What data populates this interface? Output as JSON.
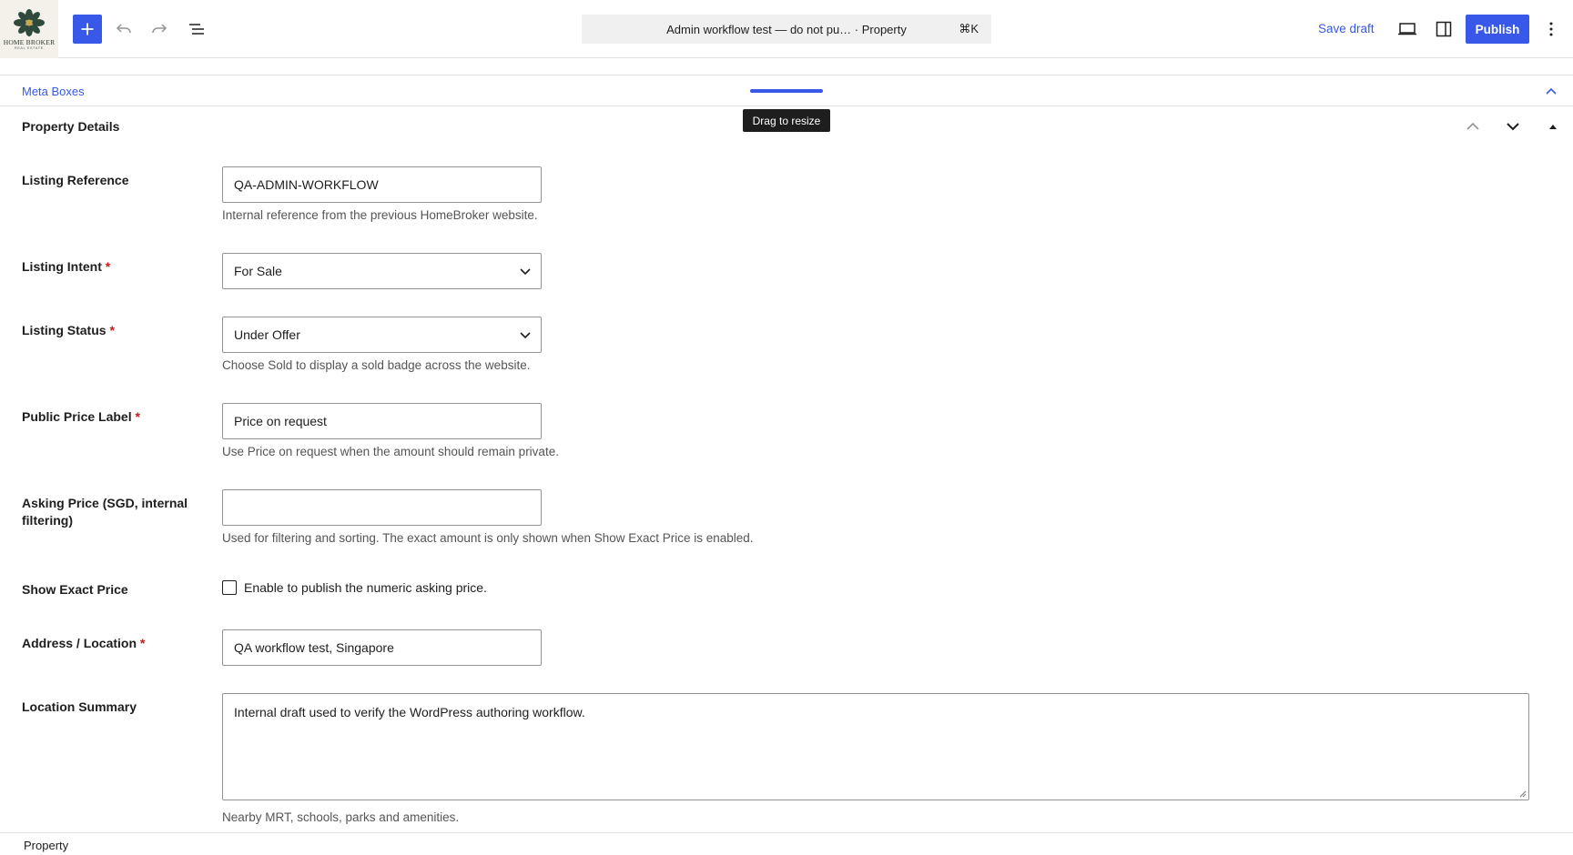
{
  "header": {
    "logo_text": "HOME BROKER",
    "logo_subtext": "REAL ESTATE",
    "command_title": "Admin workflow test — do not pu… · Property",
    "command_shortcut": "⌘K",
    "save_draft_label": "Save draft",
    "publish_label": "Publish",
    "icons": [
      "plus-icon",
      "undo-icon",
      "redo-icon",
      "list-view-icon",
      "desktop-preview-icon",
      "sidebar-toggle-icon",
      "options-icon"
    ]
  },
  "metabox": {
    "label": "Meta Boxes",
    "resize_tooltip": "Drag to resize"
  },
  "panel": {
    "title": "Property Details"
  },
  "fields": {
    "listing_reference": {
      "label": "Listing Reference",
      "value": "QA-ADMIN-WORKFLOW",
      "help": "Internal reference from the previous HomeBroker website."
    },
    "listing_intent": {
      "label": "Listing Intent",
      "required": "*",
      "value": "For Sale"
    },
    "listing_status": {
      "label": "Listing Status",
      "required": "*",
      "value": "Under Offer",
      "help": "Choose Sold to display a sold badge across the website."
    },
    "public_price_label": {
      "label": "Public Price Label",
      "required": "*",
      "value": "Price on request",
      "help": "Use Price on request when the amount should remain private."
    },
    "asking_price": {
      "label": "Asking Price (SGD, internal filtering)",
      "value": "",
      "help": "Used for filtering and sorting. The exact amount is only shown when Show Exact Price is enabled."
    },
    "show_exact_price": {
      "label": "Show Exact Price",
      "checkbox_label": "Enable to publish the numeric asking price.",
      "checked": false
    },
    "address": {
      "label": "Address / Location",
      "required": "*",
      "value": "QA workflow test, Singapore"
    },
    "location_summary": {
      "label": "Location Summary",
      "value": "Internal draft used to verify the WordPress authoring workflow.",
      "help": "Nearby MRT, schools, parks and amenities."
    }
  },
  "footer": {
    "breadcrumb": "Property"
  },
  "colors": {
    "accent": "#3858e9",
    "required": "#cc1818"
  }
}
